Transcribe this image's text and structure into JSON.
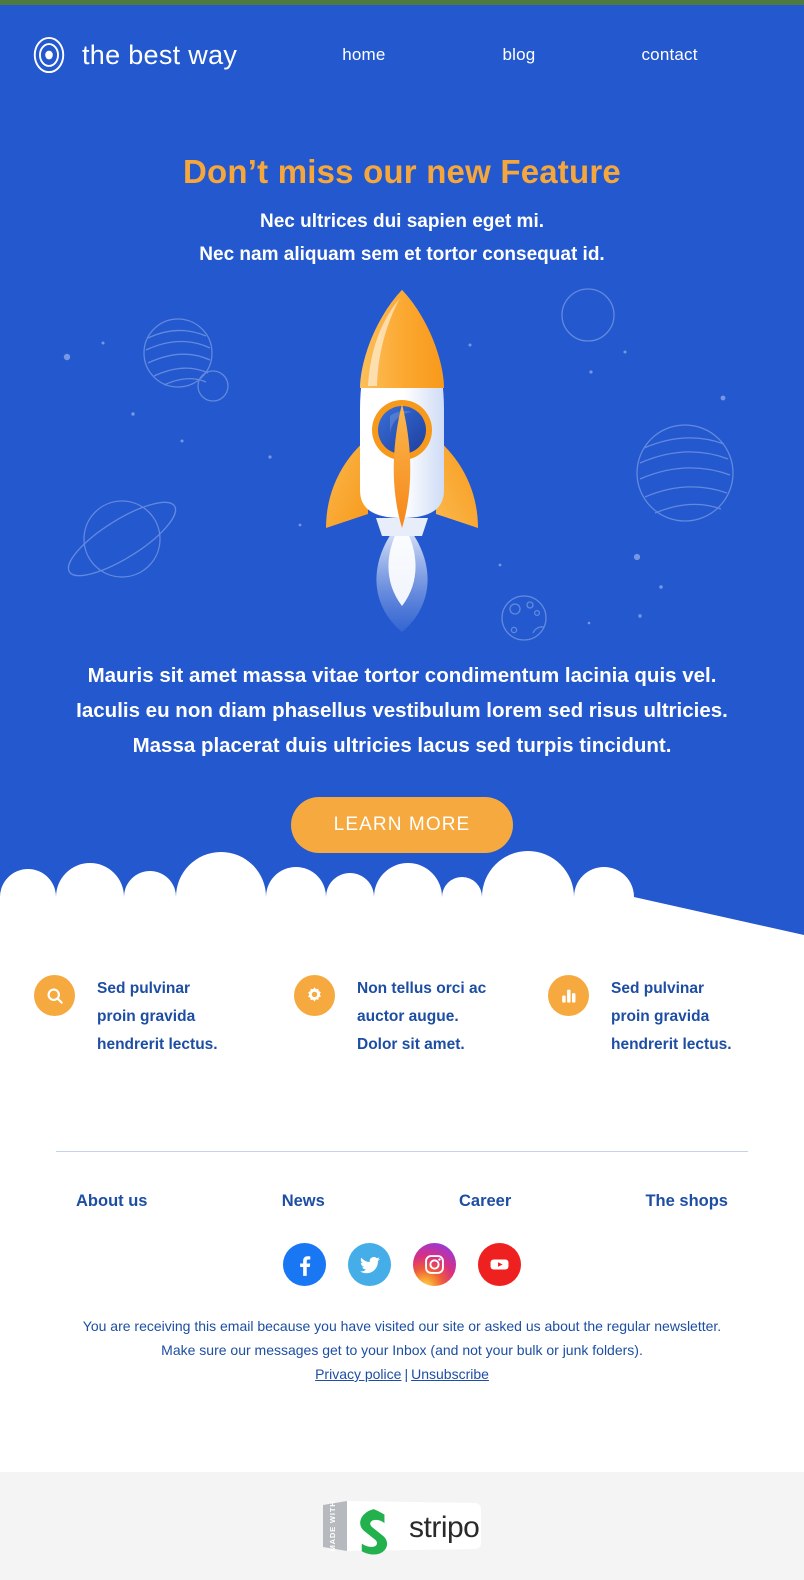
{
  "header": {
    "logo_icon": "concentric-target-icon",
    "brand_name": "the best way",
    "nav": [
      {
        "label": "home"
      },
      {
        "label": "blog"
      },
      {
        "label": "contact"
      }
    ]
  },
  "hero": {
    "headline": "Don’t miss our new Feature",
    "subhead_line1": "Nec ultrices dui sapien eget mi.",
    "subhead_line2": "Nec nam aliquam sem et tortor consequat id.",
    "illustration": "rocket-launch-illustration",
    "body_line1": "Mauris sit amet massa vitae tortor condimentum lacinia quis vel.",
    "body_line2": "Iaculis eu non diam phasellus vestibulum lorem sed risus ultricies.",
    "body_line3": "Massa placerat duis ultricies lacus sed turpis tincidunt.",
    "cta_label": "LEARN MORE",
    "background_color": "#2458ce",
    "headline_color": "#f5a73c",
    "cta_color": "#f6a93e"
  },
  "features": [
    {
      "icon": "search-icon",
      "line1": "Sed pulvinar",
      "line2": "proin gravida",
      "line3": "hendrerit lectus."
    },
    {
      "icon": "gear-icon",
      "line1": "Non tellus orci ac",
      "line2": "auctor augue.",
      "line3": "Dolor sit amet."
    },
    {
      "icon": "bar-chart-icon",
      "line1": "Sed pulvinar",
      "line2": "proin gravida",
      "line3": "hendrerit lectus."
    }
  ],
  "footer": {
    "links": [
      {
        "label": "About us"
      },
      {
        "label": "News"
      },
      {
        "label": "Career"
      },
      {
        "label": "The shops"
      }
    ],
    "socials": [
      {
        "name": "facebook-icon",
        "color": "#1977f3"
      },
      {
        "name": "twitter-icon",
        "color": "#45ade8"
      },
      {
        "name": "instagram-icon",
        "color": "#d9307f"
      },
      {
        "name": "youtube-icon",
        "color": "#ef2020"
      }
    ],
    "disclaimer_line1": "You are receiving this email because you have visited our site or asked us about the regular newsletter.",
    "disclaimer_line2": "Make sure our messages get to your Inbox (and not your bulk or junk folders).",
    "privacy_label": "Privacy police",
    "separator": "|",
    "unsubscribe_label": "Unsubscribe",
    "text_color": "#1d4ea3"
  },
  "badge": {
    "tab_text": "MADE WITH",
    "wordmark": "stripo",
    "logo_icon": "stripo-s-logo",
    "logo_color": "#22b14c"
  }
}
